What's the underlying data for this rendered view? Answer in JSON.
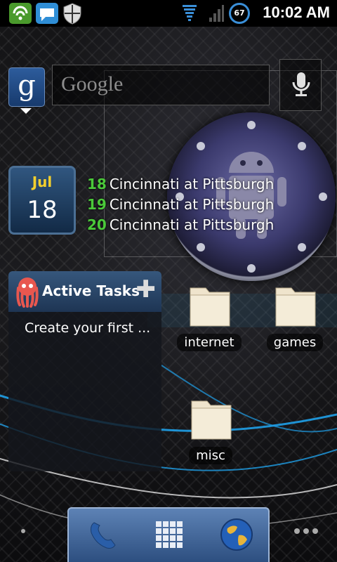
{
  "status_bar": {
    "time": "10:02 AM",
    "battery_percent": "67",
    "icons": [
      "shield-icon",
      "chat-sync-icon",
      "security-shield-icon",
      "signal-icon",
      "cell-signal-icon",
      "battery-icon"
    ]
  },
  "search_widget": {
    "logo_glyph": "g",
    "placeholder": "Google",
    "mic_icon": "microphone-icon"
  },
  "calendar_widget": {
    "month": "Jul",
    "day": "18",
    "events": [
      {
        "day": "18",
        "title": "Cincinnati at Pittsburgh"
      },
      {
        "day": "19",
        "title": "Cincinnati at Pittsburgh"
      },
      {
        "day": "20",
        "title": "Cincinnati at Pittsburgh"
      }
    ]
  },
  "tasks_widget": {
    "title": "Active Tasks",
    "add_glyph": "✚",
    "empty_text": "Create your first ..."
  },
  "folders": [
    {
      "label": "internet"
    },
    {
      "label": "games"
    },
    {
      "label": "misc"
    }
  ],
  "dock": {
    "items": [
      "phone-icon",
      "app-drawer-icon",
      "browser-globe-icon"
    ]
  },
  "colors": {
    "accent_blue": "#3a8fd8",
    "event_day_green": "#4bc93a",
    "calendar_month_yellow": "#f2cf2d"
  }
}
